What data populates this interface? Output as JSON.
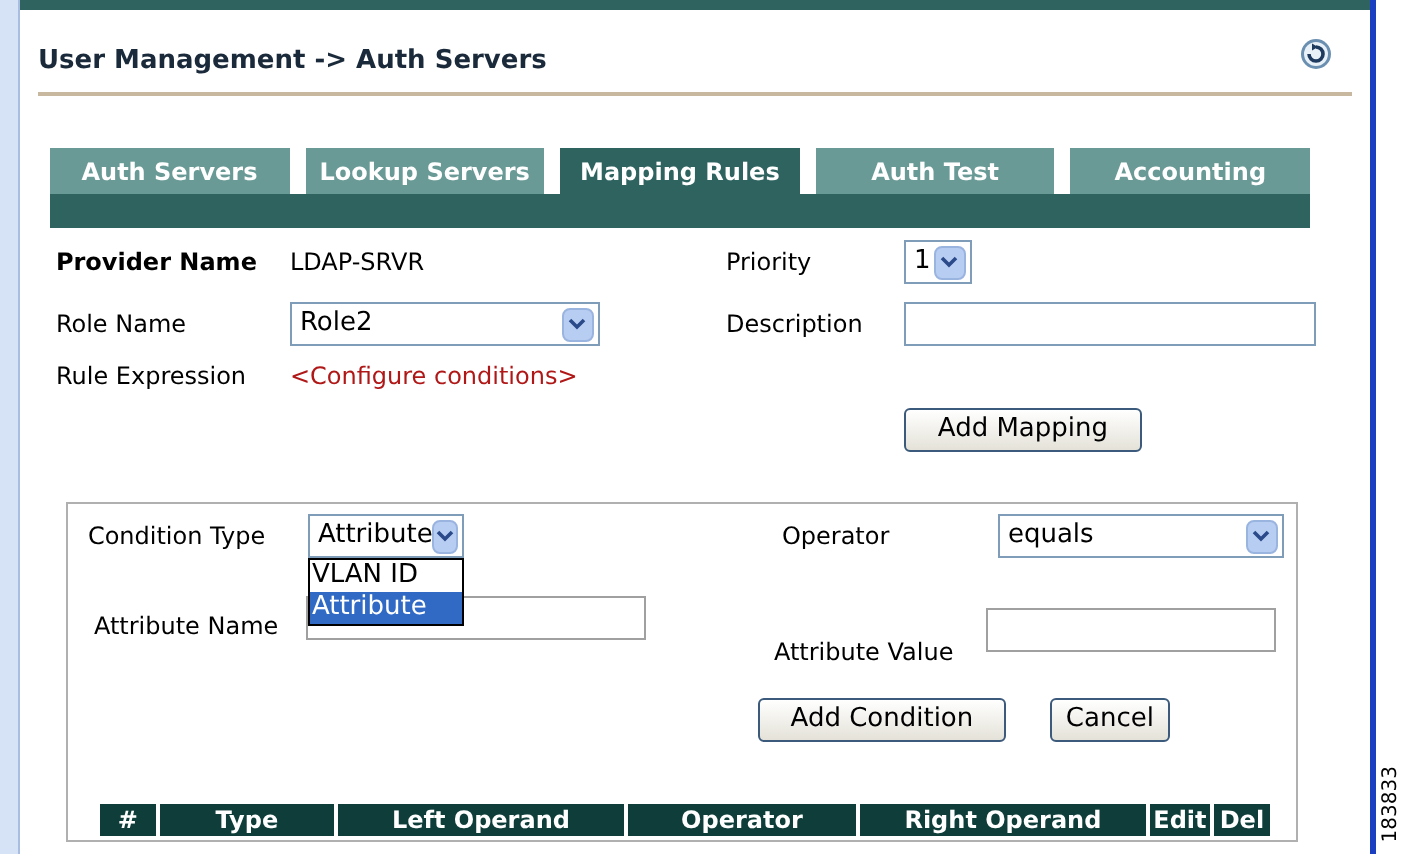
{
  "page_title": "User Management -> Auth Servers",
  "tabs": [
    {
      "label": "Auth Servers",
      "selected": false
    },
    {
      "label": "Lookup Servers",
      "selected": false
    },
    {
      "label": "Mapping Rules",
      "selected": true
    },
    {
      "label": "Auth Test",
      "selected": false
    },
    {
      "label": "Accounting",
      "selected": false
    }
  ],
  "form": {
    "provider_name": {
      "label": "Provider Name",
      "value": "LDAP-SRVR"
    },
    "priority": {
      "label": "Priority",
      "value": "1"
    },
    "role_name": {
      "label": "Role Name",
      "value": "Role2"
    },
    "description": {
      "label": "Description"
    },
    "rule_expression": {
      "label": "Rule Expression",
      "link": "<Configure conditions>"
    },
    "add_button": "Add Mapping"
  },
  "condition": {
    "condition_type": {
      "label": "Condition Type",
      "value": "Attribute",
      "expanded": true,
      "options": [
        {
          "label": "VLAN ID",
          "selected": false
        },
        {
          "label": "Attribute",
          "selected": true
        }
      ]
    },
    "operator": {
      "label": "Operator",
      "value": "equals"
    },
    "attribute_name": {
      "label": "Attribute Name"
    },
    "attribute_value": {
      "label": "Attribute Value"
    },
    "buttons": [
      "Add Condition",
      "Cancel"
    ],
    "table": {
      "columns": [
        "#",
        "Type",
        "Left Operand",
        "Operator",
        "Right Operand",
        "Edit",
        "Del"
      ]
    }
  },
  "figure_number": "183833"
}
